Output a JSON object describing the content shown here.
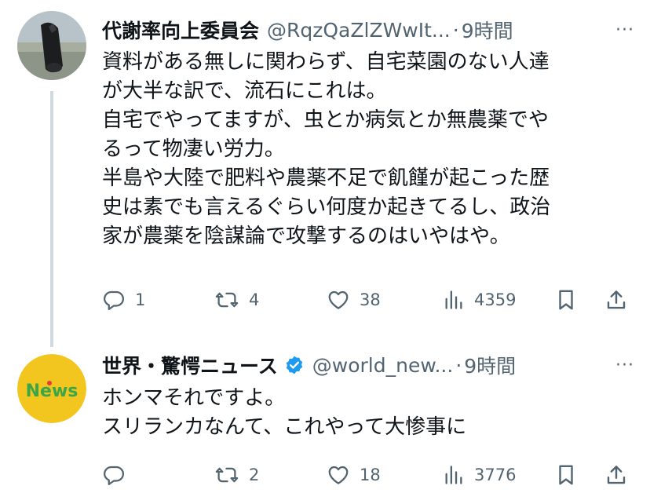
{
  "posts": [
    {
      "name": "代謝率向上委員会",
      "handle": "@RqzQaZlZWwIt...",
      "separator": "·",
      "time": "9時間",
      "more": "···",
      "verified": false,
      "lines": [
        "資料がある無しに関わらず、自宅菜園のない人達",
        "が大半な訳で、流石にこれは。",
        "自宅でやってますが、虫とか病気とか無農薬でや",
        "るって物凄い労力。",
        "半島や大陸で肥料や農薬不足で飢饉が起こった歴",
        "史は素でも言えるぐらい何度か起きてるし、政治",
        "家が農薬を陰謀論で攻撃するのはいやはや。"
      ],
      "replies": "1",
      "reposts": "4",
      "likes": "38",
      "views": "4359"
    },
    {
      "name": "世界・驚愕ニュース",
      "handle": "@world_new...",
      "separator": "·",
      "time": "9時間",
      "more": "···",
      "verified": true,
      "avatar_text": "News",
      "lines": [
        "ホンマそれですよ。",
        "スリランカなんて、これやって大惨事に"
      ],
      "replies": "",
      "reposts": "2",
      "likes": "18",
      "views": "3776"
    }
  ],
  "colors": {
    "text": "#0f1419",
    "secondary": "#536471",
    "verified": "#1d9bf0",
    "thread_line": "#cfd9de",
    "news_yellow": "#f3c51f",
    "news_green": "#3aa64a",
    "news_red": "#e23b3b"
  }
}
